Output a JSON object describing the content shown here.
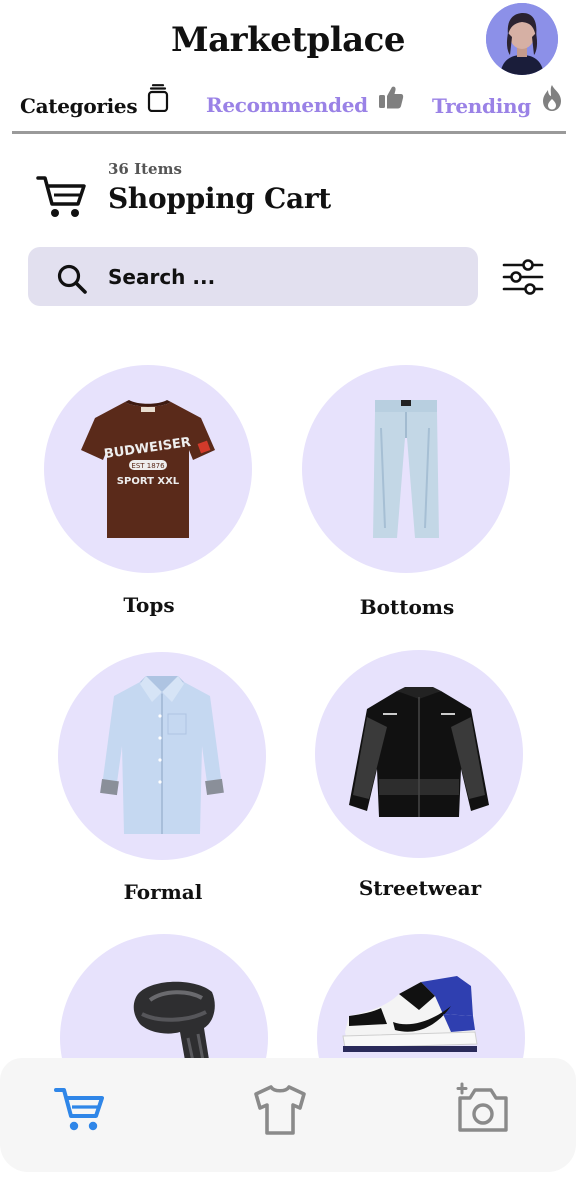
{
  "app": {
    "title": "Marketplace"
  },
  "tabs": [
    {
      "label": "Categories",
      "icon": "stack-icon",
      "active": true
    },
    {
      "label": "Recommended",
      "icon": "thumbs-up-icon",
      "active": false
    },
    {
      "label": "Trending",
      "icon": "flame-icon",
      "active": false
    }
  ],
  "cart": {
    "count_label": "36 Items",
    "title": "Shopping Cart"
  },
  "search": {
    "placeholder": "Search ..."
  },
  "categories": [
    {
      "label": "Tops",
      "image": "t-shirt",
      "shirt_text": [
        "BUDWEISER",
        "EST 1876",
        "SPORT XXL"
      ]
    },
    {
      "label": "Bottoms",
      "image": "jeans"
    },
    {
      "label": "Formal",
      "image": "dress-shirt"
    },
    {
      "label": "Streetwear",
      "image": "track-jacket"
    },
    {
      "label": "",
      "image": "scarf"
    },
    {
      "label": "",
      "image": "sneaker"
    }
  ],
  "bottom_nav": [
    {
      "icon": "cart-icon",
      "active": true
    },
    {
      "icon": "shirt-icon",
      "active": false
    },
    {
      "icon": "camera-icon",
      "active": false
    }
  ],
  "colors": {
    "accent": "#9a82e6",
    "circle_bg": "#e7e2fc",
    "search_bg": "#e2e0ef",
    "nav_active": "#2f86e8",
    "nav_inactive": "#8a8a8a"
  }
}
